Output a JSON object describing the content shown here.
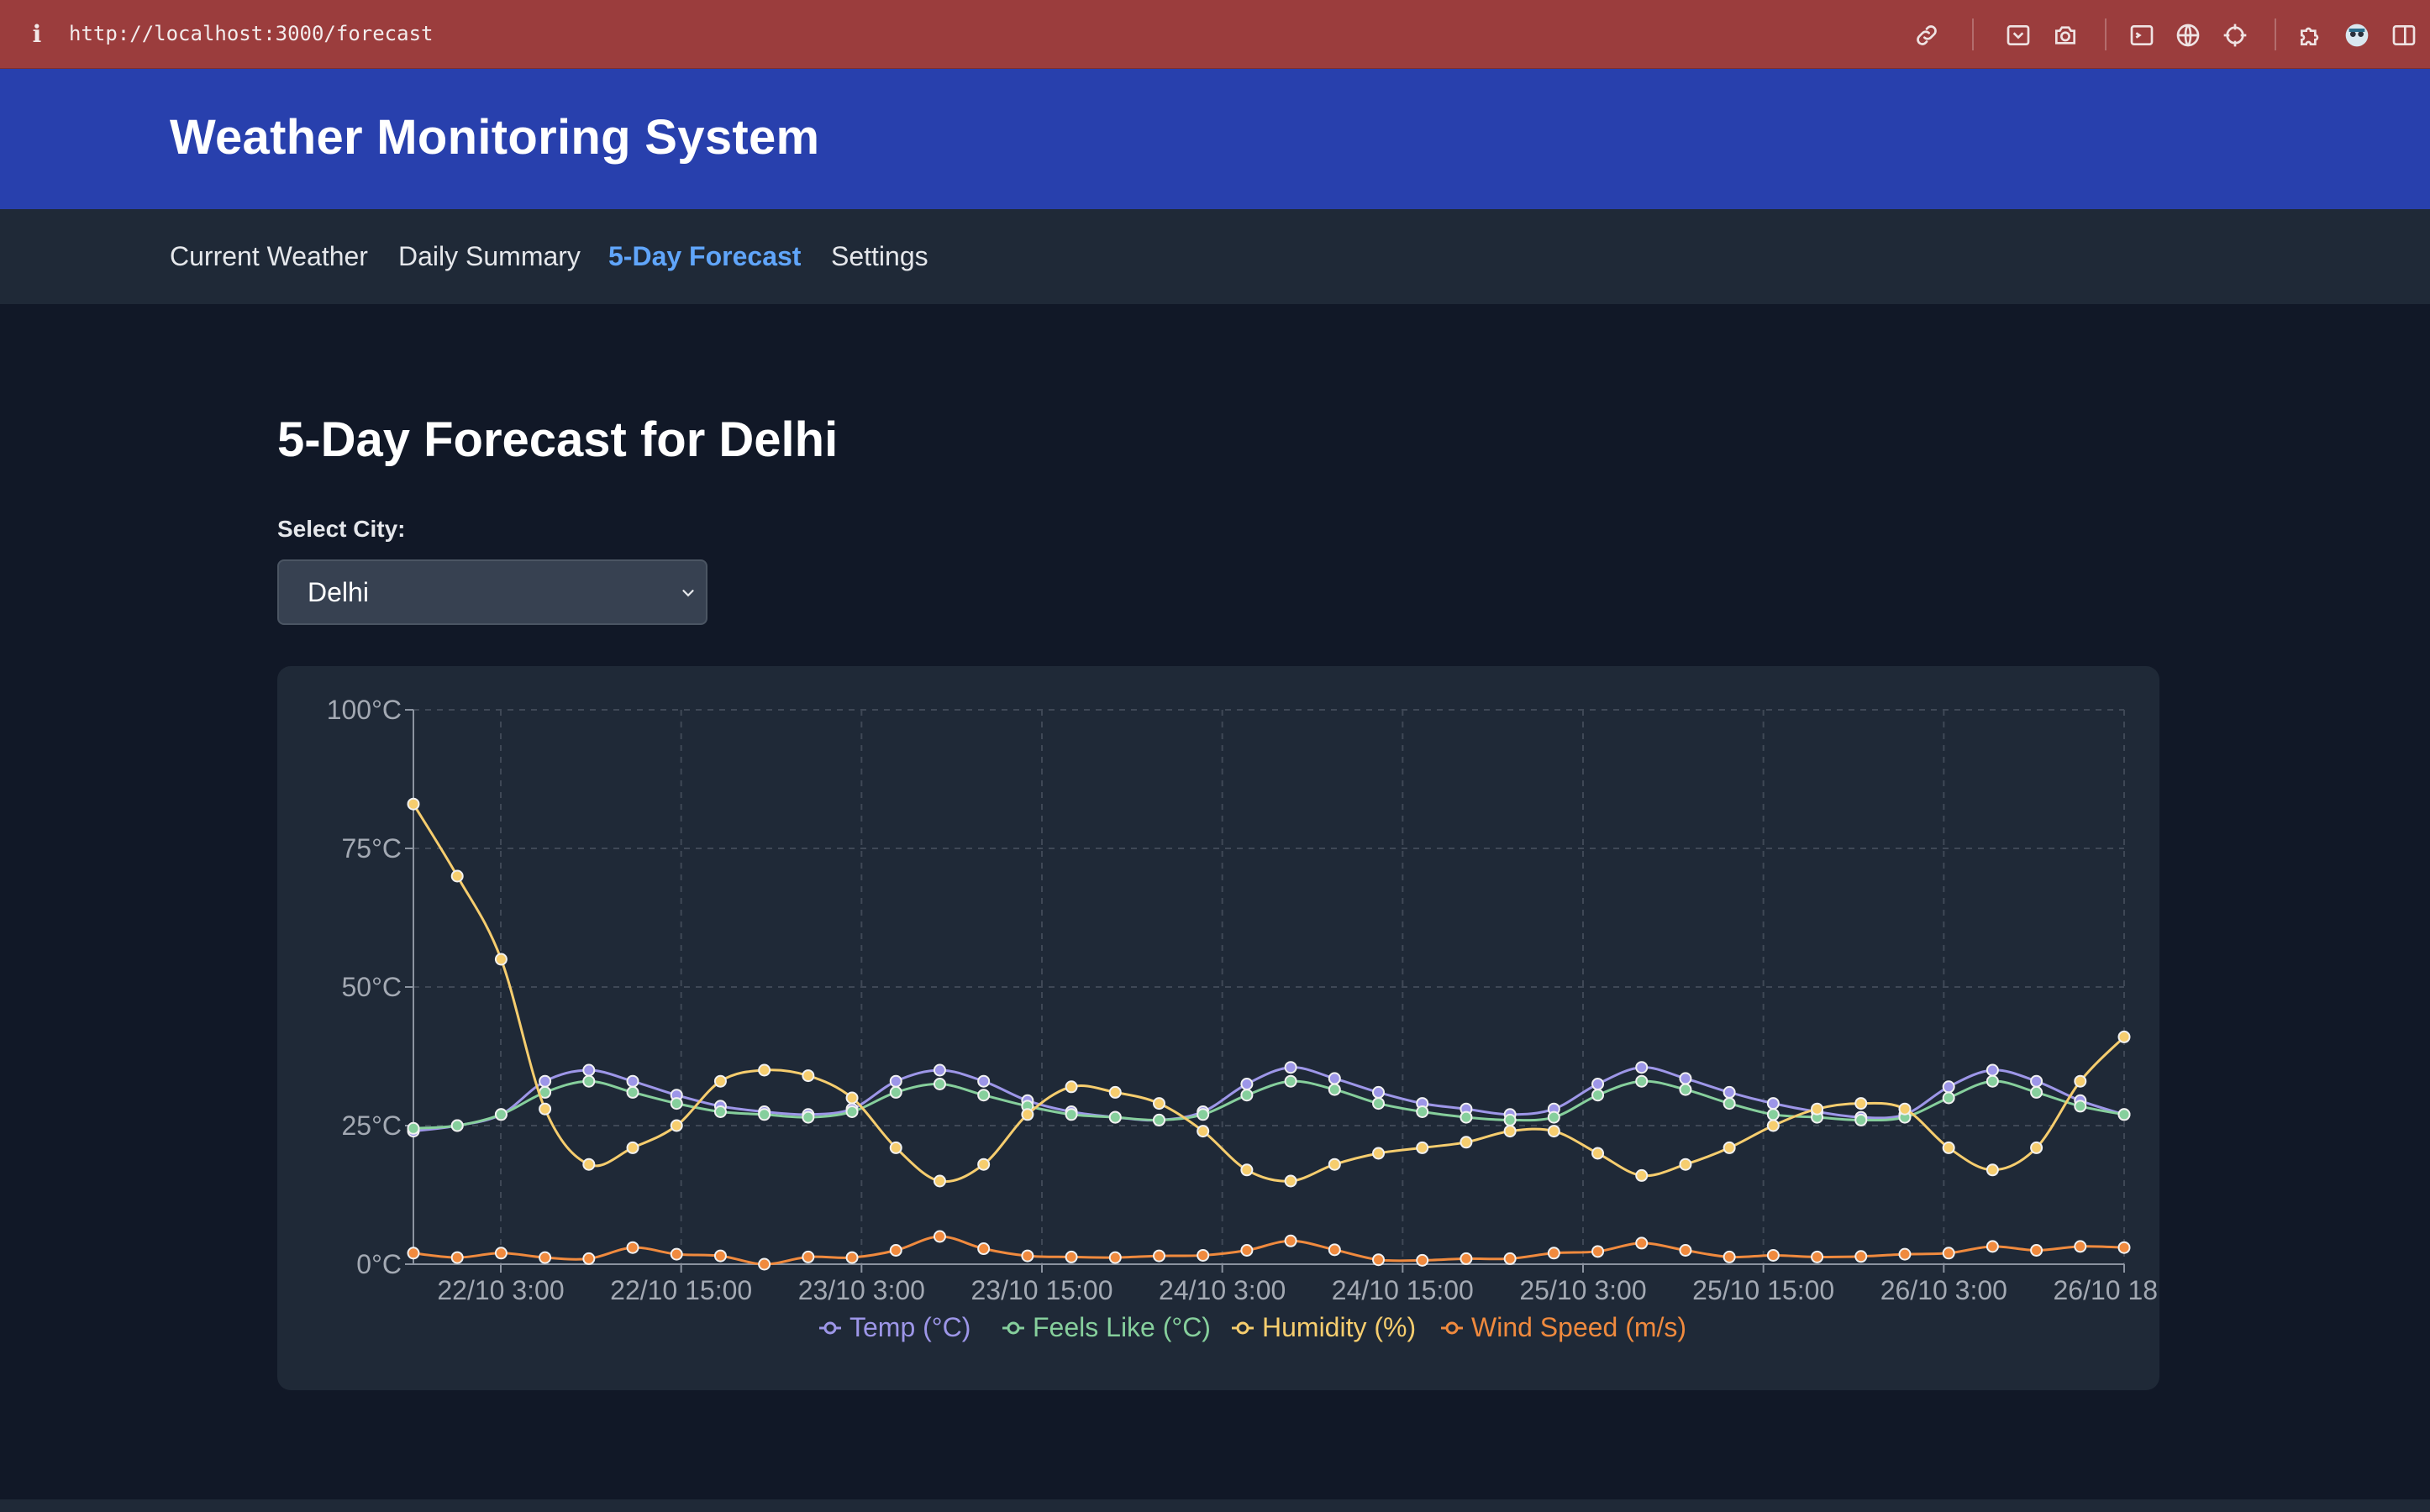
{
  "browser": {
    "url": "http://localhost:3000/forecast",
    "icons": [
      "info-icon",
      "link-icon",
      "screenshot-icon",
      "camera-icon",
      "terminal-icon",
      "globe-icon",
      "crosshair-icon",
      "puzzle-icon",
      "profile-icon",
      "sidebar-icon"
    ]
  },
  "header": {
    "title": "Weather Monitoring System"
  },
  "nav": {
    "items": [
      {
        "label": "Current Weather",
        "active": false
      },
      {
        "label": "Daily Summary",
        "active": false
      },
      {
        "label": "5-Day Forecast",
        "active": true
      },
      {
        "label": "Settings",
        "active": false
      }
    ]
  },
  "main": {
    "title": "5-Day Forecast for Delhi",
    "select_label": "Select City:",
    "selected_city": "Delhi"
  },
  "colors": {
    "header_bg": "#2840ad",
    "nav_active": "#60a5fa",
    "temp": "#9d96e8",
    "feels_like": "#86cf9c",
    "humidity": "#f6cd6e",
    "wind": "#f08a3e"
  },
  "chart_data": {
    "type": "line",
    "x_tick_labels": [
      "22/10 3:00",
      "22/10 15:00",
      "23/10 3:00",
      "23/10 15:00",
      "24/10 3:00",
      "24/10 15:00",
      "25/10 3:00",
      "25/10 15:00",
      "26/10 3:00",
      "26/10 18:00"
    ],
    "y_tick_labels": [
      "0°C",
      "25°C",
      "50°C",
      "75°C",
      "100°C"
    ],
    "ylim": [
      0,
      100
    ],
    "grid": true,
    "legend_position": "bottom",
    "series": [
      {
        "name": "Temp (°C)",
        "color": "#9d96e8",
        "values": [
          24,
          25,
          27,
          33,
          35,
          33,
          30.5,
          28.5,
          27.5,
          27,
          28,
          33,
          35,
          33,
          29.5,
          27.5,
          26.5,
          26,
          27.5,
          32.5,
          35.5,
          33.5,
          31,
          29,
          28,
          27,
          28,
          32.5,
          35.5,
          33.5,
          31,
          29,
          27.5,
          26.5,
          27,
          32,
          35,
          33,
          29.5,
          27
        ]
      },
      {
        "name": "Feels Like (°C)",
        "color": "#86cf9c",
        "values": [
          24.5,
          25,
          27,
          31,
          33,
          31,
          29,
          27.5,
          27,
          26.5,
          27.5,
          31,
          32.5,
          30.5,
          28.5,
          27,
          26.5,
          26,
          27,
          30.5,
          33,
          31.5,
          29,
          27.5,
          26.5,
          26,
          26.5,
          30.5,
          33,
          31.5,
          29,
          27,
          26.5,
          26,
          26.5,
          30,
          33,
          31,
          28.5,
          27
        ]
      },
      {
        "name": "Humidity (%)",
        "color": "#f6cd6e",
        "values": [
          83,
          70,
          55,
          28,
          18,
          21,
          25,
          33,
          35,
          34,
          30,
          21,
          15,
          18,
          27,
          32,
          31,
          29,
          24,
          17,
          15,
          18,
          20,
          21,
          22,
          24,
          24,
          20,
          16,
          18,
          21,
          25,
          28,
          29,
          28,
          21,
          17,
          21,
          33,
          41
        ]
      },
      {
        "name": "Wind Speed (m/s)",
        "color": "#f08a3e",
        "values": [
          2,
          1.2,
          2,
          1.2,
          1,
          3,
          1.8,
          1.5,
          0,
          1.3,
          1.2,
          2.5,
          5,
          2.8,
          1.5,
          1.3,
          1.2,
          1.5,
          1.6,
          2.5,
          4.2,
          2.6,
          0.8,
          0.7,
          1,
          1,
          2,
          2.3,
          3.8,
          2.5,
          1.3,
          1.6,
          1.3,
          1.4,
          1.8,
          2,
          3.2,
          2.5,
          3.2,
          3
        ]
      }
    ]
  }
}
